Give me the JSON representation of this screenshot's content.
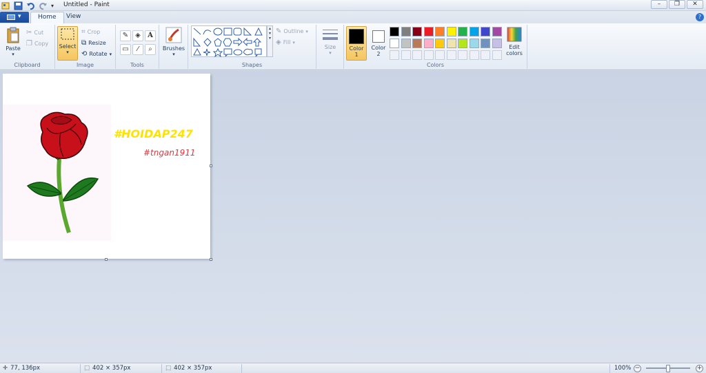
{
  "window": {
    "title": "Untitled - Paint"
  },
  "tabs": [
    {
      "label": "Home"
    },
    {
      "label": "View"
    }
  ],
  "clipboard": {
    "paste": "Paste",
    "cut": "Cut",
    "copy": "Copy",
    "group": "Clipboard"
  },
  "image": {
    "select": "Select",
    "crop": "Crop",
    "resize": "Resize",
    "rotate": "Rotate",
    "group": "Image"
  },
  "tools": {
    "group": "Tools"
  },
  "brushes": {
    "label": "Brushes"
  },
  "shapes": {
    "outline": "Outline",
    "fill": "Fill",
    "group": "Shapes"
  },
  "size": {
    "label": "Size"
  },
  "colors": {
    "color1": "Color 1",
    "color2": "Color 2",
    "edit": "Edit colors",
    "group": "Colors",
    "color1_value": "#000000",
    "color2_value": "#ffffff",
    "palette_row1": [
      "#000000",
      "#7f7f7f",
      "#880015",
      "#ed1c24",
      "#ff7f27",
      "#fff200",
      "#22b14c",
      "#00a2e8",
      "#3f48cc",
      "#a349a4"
    ],
    "palette_row2": [
      "#ffffff",
      "#c3c3c3",
      "#b97a57",
      "#ffaec9",
      "#ffc90e",
      "#efe4b0",
      "#b5e61d",
      "#99d9ea",
      "#7092be",
      "#c8bfe7"
    ]
  },
  "canvas": {
    "text1": "#HOIDAP247",
    "text2": "#tngan1911",
    "text1_color": "#ffe300",
    "text2_color": "#e8323c"
  },
  "status": {
    "cursor": "77, 136px",
    "selection": "402 × 357px",
    "image_size": "402 × 357px",
    "zoom": "100%"
  }
}
